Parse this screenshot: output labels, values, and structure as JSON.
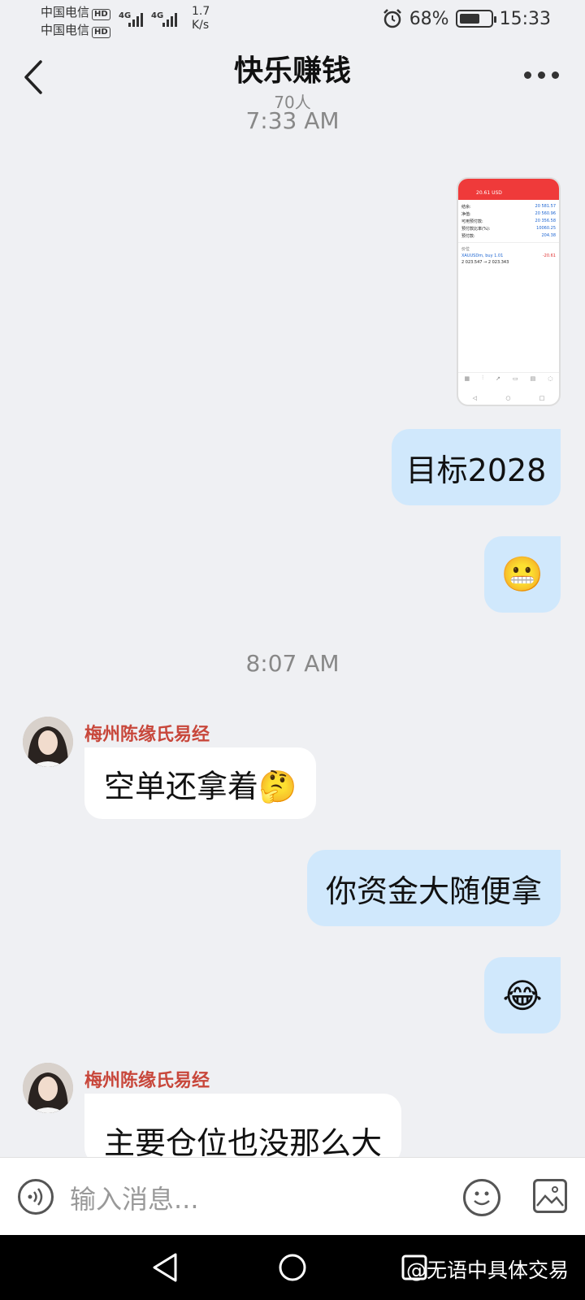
{
  "status": {
    "carrier1": "中国电信",
    "carrier2": "中国电信",
    "hd": "HD",
    "net": "4G",
    "speed_value": "1.7",
    "speed_unit": "K/s",
    "battery": "68%",
    "battery_level": 0.68,
    "clock": "15:33"
  },
  "header": {
    "title": "快乐赚钱",
    "members": "70人"
  },
  "thumb": {
    "account": "20.61 USD",
    "rows": [
      {
        "k": "结余:",
        "v": "20 581.57"
      },
      {
        "k": "净值:",
        "v": "20 560.96"
      },
      {
        "k": "可用预付款:",
        "v": "20 356.58"
      },
      {
        "k": "预付款比率(%):",
        "v": "10060.25"
      },
      {
        "k": "预付款:",
        "v": "204.38"
      }
    ],
    "position_label": "价位",
    "position_symbol": "XAUUSDm, buy 1.01",
    "position_price": "2 023.547 → 2 023.343",
    "position_profit": "-20.61"
  },
  "messages": {
    "time1": "7:33 AM",
    "msg1": "目标2028",
    "msg2_emoji": "😬",
    "time2": "8:07 AM",
    "sender1": "梅州陈缘氏易经",
    "msg3": "空单还拿着🤔",
    "msg4": "你资金大随便拿",
    "msg5_emoji": "😂",
    "sender2": "梅州陈缘氏易经",
    "msg6": "主要仓位也没那么大"
  },
  "input": {
    "placeholder": "输入消息..."
  },
  "watermark": "@无语中具体交易"
}
